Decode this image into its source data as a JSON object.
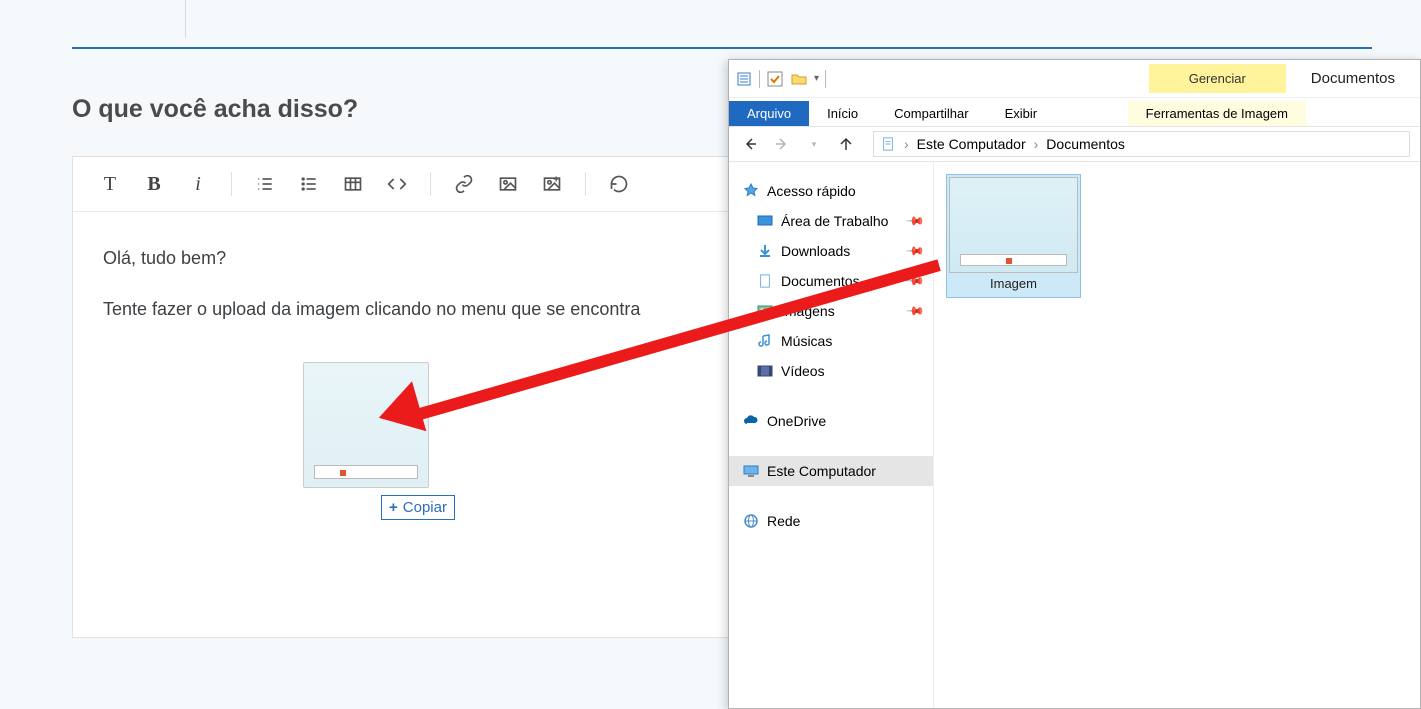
{
  "page": {
    "title": "O que você acha disso?"
  },
  "editor": {
    "line1": "Olá, tudo bem?",
    "line2": "Tente fazer o upload da imagem clicando no menu que se encontra",
    "copy_badge": "Copiar"
  },
  "explorer": {
    "title": "Documentos",
    "highlight_tab": "Gerenciar",
    "ribbon": {
      "file": "Arquivo",
      "home": "Início",
      "share": "Compartilhar",
      "view": "Exibir",
      "context": "Ferramentas de Imagem"
    },
    "breadcrumb": {
      "root": "Este Computador",
      "current": "Documentos"
    },
    "navpane": {
      "quick_access": "Acesso rápido",
      "desktop": "Área de Trabalho",
      "downloads": "Downloads",
      "documents": "Documentos",
      "images": "Imagens",
      "music": "Músicas",
      "videos": "Vídeos",
      "onedrive": "OneDrive",
      "this_pc": "Este Computador",
      "network": "Rede"
    },
    "file": {
      "name": "Imagem"
    }
  }
}
